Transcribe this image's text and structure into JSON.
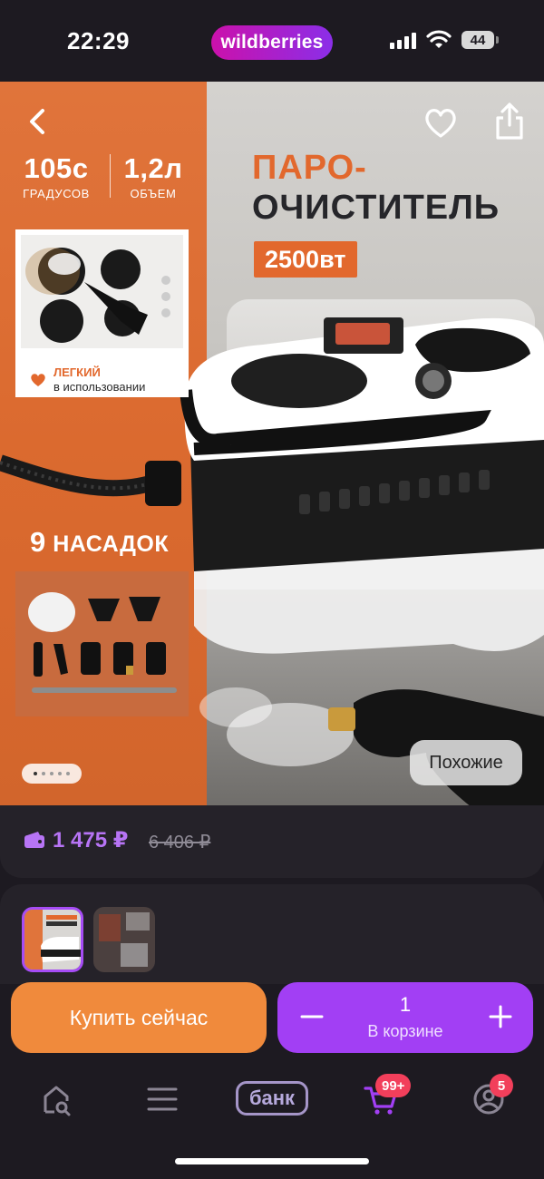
{
  "status_bar": {
    "time": "22:29",
    "app_brand": "wildberries",
    "battery": "44"
  },
  "product_image": {
    "specs": [
      {
        "value": "105с",
        "label": "ГРАДУСОВ"
      },
      {
        "value": "1,2л",
        "label": "ОБЪЕМ"
      }
    ],
    "title_line1": "ПАРО-",
    "title_line2": "ОЧИСТИТЕЛЬ",
    "power": "2500вт",
    "feature_bold": "ЛЕГКИЙ",
    "feature_text": "в использовании",
    "attachments_count": "9",
    "attachments_label": "НАСАДОК",
    "similar_label": "Похожие",
    "carousel": {
      "total": 5,
      "active": 0
    }
  },
  "price": {
    "current": "1 475 ₽",
    "old": "6 406 ₽"
  },
  "actions": {
    "buy_now": "Купить сейчас",
    "cart_quantity": "1",
    "cart_label": "В корзине"
  },
  "bottom_nav": {
    "bank_label": "банк",
    "cart_badge": "99+",
    "profile_badge": "5"
  },
  "colors": {
    "accent_purple": "#a23ff4",
    "accent_orange": "#f08a3c",
    "product_orange": "#e2682d",
    "badge_red": "#f23f5b",
    "background": "#1d1a21"
  },
  "icons": [
    "chevron-left-icon",
    "heart-icon",
    "share-icon",
    "wallet-icon",
    "minus-icon",
    "plus-icon",
    "home-search-icon",
    "menu-icon",
    "cart-icon",
    "profile-icon",
    "signal-icon",
    "wifi-icon"
  ]
}
